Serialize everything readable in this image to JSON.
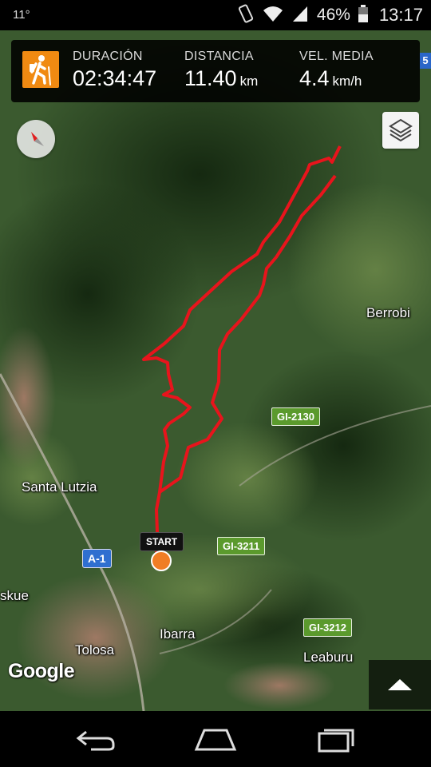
{
  "status": {
    "notification": "11°",
    "battery": "46%",
    "time": "13:17"
  },
  "stats": {
    "duration": {
      "label": "DURACIÓN",
      "value": "02:34:47",
      "unit": ""
    },
    "distance": {
      "label": "DISTANCIA",
      "value": "11.40",
      "unit": "km"
    },
    "speed": {
      "label": "VEL. MEDIA",
      "value": "4.4",
      "unit": "km/h"
    }
  },
  "map": {
    "route_color": "#e8141c",
    "start_label": "START",
    "places": {
      "berrobi": "Berrobi",
      "santa_lutzia": "Santa Lutzia",
      "skue": "skue",
      "tolosa": "Tolosa",
      "ibarra": "Ibarra",
      "leaburu": "Leaburu"
    },
    "roads": {
      "gi2130": "GI-2130",
      "gi3211": "GI-3211",
      "gi3212": "GI-3212",
      "a1": "A-1",
      "shield5": "5"
    },
    "attribution": "Google"
  },
  "icons": {
    "activity": "hiking-icon",
    "compass": "compass-icon",
    "layers": "layers-icon",
    "expand": "chevron-up-icon"
  },
  "nav": {
    "back": "back-icon",
    "home": "home-icon",
    "recents": "recents-icon"
  }
}
